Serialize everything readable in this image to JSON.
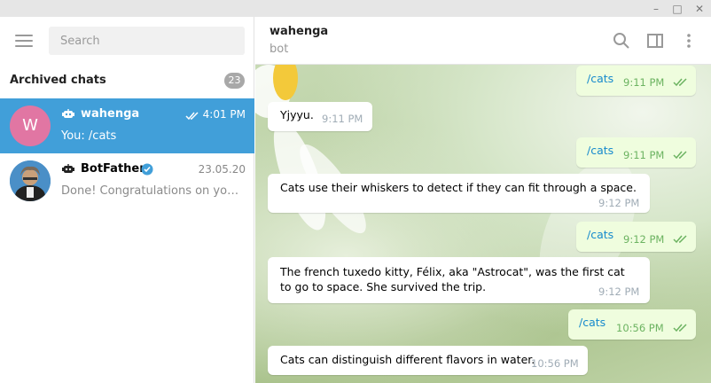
{
  "window": {
    "minimize": "–",
    "maximize": "□",
    "close": "✕"
  },
  "sidebar": {
    "search_placeholder": "Search",
    "archived_title": "Archived chats",
    "archived_count": "23",
    "chats": [
      {
        "name": "wahenga",
        "time": "4:01 PM",
        "preview": "You: /cats",
        "avatar_letter": "W"
      },
      {
        "name": "BotFather",
        "time": "23.05.20",
        "preview": "Done! Congratulations on your new bot."
      }
    ]
  },
  "header": {
    "name": "wahenga",
    "status": "bot"
  },
  "messages": [
    {
      "dir": "out",
      "text": "/cats",
      "time": "9:11 PM"
    },
    {
      "dir": "in",
      "text": "Yjyyu.",
      "time": "9:11 PM"
    },
    {
      "dir": "out",
      "text": "/cats",
      "time": "9:11 PM"
    },
    {
      "dir": "in",
      "text": "Cats use their whiskers to detect if they can fit through a space.",
      "time": "9:12 PM"
    },
    {
      "dir": "out",
      "text": "/cats",
      "time": "9:12 PM"
    },
    {
      "dir": "in",
      "text": "The french tuxedo kitty, Félix, aka \"Astrocat\", was the first cat to go to space. She survived the trip.",
      "time": "9:12 PM"
    },
    {
      "dir": "out",
      "text": "/cats",
      "time": "10:56 PM"
    },
    {
      "dir": "in",
      "text": "Cats can distinguish different flavors in water.",
      "time": "10:56 PM"
    }
  ],
  "colors": {
    "accent": "#419fd9",
    "outgoing_bubble": "#effdde",
    "read_tick": "#6cb361",
    "link": "#168acd"
  }
}
